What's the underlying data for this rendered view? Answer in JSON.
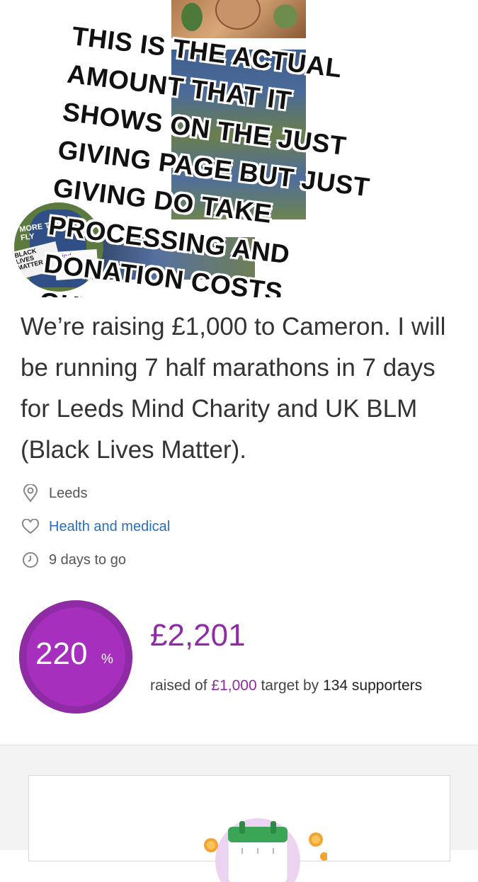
{
  "overlay": {
    "caption": "THIS IS THE ACTUAL\nAMOUNT THAT IT\nSHOWS ON THE JUST\nGIVING PAGE BUT JUST\nGIVING DO TAKE\nPROCESSING AND\nDONATION COSTS\nGUYS!",
    "emoji": "thumbs-up-icon"
  },
  "avatar": {
    "shirt_text": "MORE THAN\nFLY",
    "sign_text": "BLACK\nLIVES\nMATTER",
    "sign2_text": "mind"
  },
  "page": {
    "description": "We’re raising £1,000 to Cameron. I will be running 7 half marathons in 7 days for Leeds Mind Charity and UK BLM (Black Lives Matter).",
    "location": "Leeds",
    "category": "Health and medical",
    "time_left": "9 days to go"
  },
  "progress": {
    "percent_value": "220",
    "percent_sign": "%",
    "percent_fraction": 1.0,
    "raised": "£2,201",
    "raised_prefix": "raised of",
    "target": "£1,000",
    "target_mid": "target by",
    "supporters": "134 supporters"
  },
  "colors": {
    "brand_purple": "#8e2ba5",
    "link_blue": "#2a6ebb"
  },
  "icons": {
    "location": "location-pin-icon",
    "category": "heart-icon",
    "time": "clock-icon",
    "card": "calendar-icon"
  }
}
